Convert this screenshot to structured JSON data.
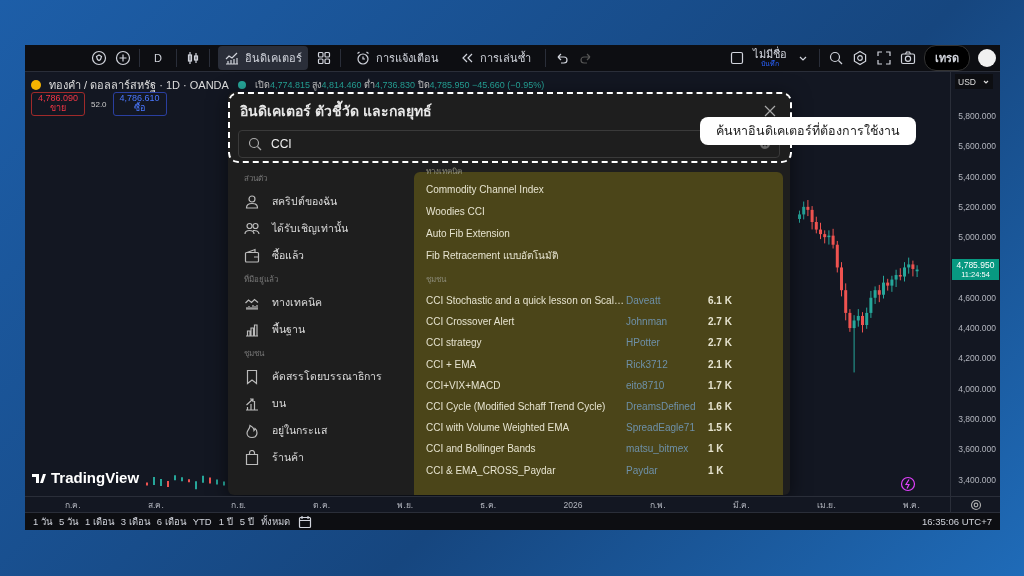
{
  "toolbar": {
    "interval": "D",
    "indicators": {
      "label": "อินดิเคเตอร์",
      "selected": true
    },
    "alerts_label": "การแจ้งเตือน",
    "replay_label": "การเล่นซ้ำ",
    "layout_name": "ไม่มีชื่อ",
    "layout_status": "บันทึก",
    "trade_button": "เทรด"
  },
  "legend": {
    "symbol": "ทองคำ / ดอลลาร์สหรัฐ · 1D · OANDA",
    "ohlc": [
      {
        "label": "เปิด",
        "value": "4,774.815"
      },
      {
        "label": "สูง",
        "value": "4,814.460"
      },
      {
        "label": "ต่ำ",
        "value": "4,736.830"
      },
      {
        "label": "ปิด",
        "value": "4,785.950"
      }
    ],
    "change": "−45.660 (−0.95%)"
  },
  "quote": {
    "sell_price": "4,786.090",
    "sell_label": "ขาย",
    "spread": "52.0",
    "buy_price": "4,786.610",
    "buy_label": "ซื้อ"
  },
  "chart": {
    "chart_data": {
      "type": "candlestick",
      "categories": [
        null,
        null,
        null,
        null,
        null,
        null,
        null,
        null,
        null,
        null,
        null,
        null,
        null,
        null,
        null,
        null,
        null,
        null,
        null,
        null,
        null,
        null,
        null,
        null,
        null,
        null,
        null,
        null,
        null
      ],
      "ohlc": [
        [
          5120,
          5175,
          5095,
          5150
        ],
        [
          5150,
          5235,
          5117,
          5200
        ],
        [
          5200,
          5245,
          5139,
          5180
        ],
        [
          5180,
          5205,
          5051,
          5100
        ],
        [
          5100,
          5135,
          5025,
          5050
        ],
        [
          5050,
          5095,
          4987,
          5020
        ],
        [
          5020,
          5045,
          4959,
          5000
        ],
        [
          5000,
          5045,
          4951,
          5010
        ],
        [
          5010,
          5055,
          4925,
          4950
        ],
        [
          4950,
          4975,
          4767,
          4800
        ],
        [
          4800,
          4835,
          4609,
          4650
        ],
        [
          4650,
          4695,
          4451,
          4500
        ],
        [
          4500,
          4525,
          4375,
          4400
        ],
        [
          4400,
          4485,
          4107,
          4450
        ],
        [
          4450,
          4525,
          4409,
          4480
        ],
        [
          4480,
          4505,
          4371,
          4420
        ],
        [
          4420,
          4535,
          4395,
          4500
        ],
        [
          4500,
          4645,
          4467,
          4600
        ],
        [
          4600,
          4675,
          4559,
          4650
        ],
        [
          4650,
          4685,
          4571,
          4620
        ],
        [
          4620,
          4745,
          4595,
          4700
        ],
        [
          4700,
          4725,
          4647,
          4680
        ],
        [
          4680,
          4745,
          4639,
          4720
        ],
        [
          4720,
          4785,
          4671,
          4750
        ],
        [
          4750,
          4795,
          4715,
          4740
        ],
        [
          4740,
          4835,
          4707,
          4800
        ],
        [
          4800,
          4865,
          4759,
          4820
        ],
        [
          4820,
          4845,
          4741,
          4790
        ],
        [
          4774.815,
          4814.46,
          4736.83,
          4785.95
        ]
      ],
      "ylim": [
        3186,
        6090
      ],
      "yticks": [
        {
          "value": 5800,
          "label": "5,800.000"
        },
        {
          "value": 5600,
          "label": "5,600.000"
        },
        {
          "value": 5400,
          "label": "5,400.000"
        },
        {
          "value": 5200,
          "label": "5,200.000"
        },
        {
          "value": 5000,
          "label": "5,000.000"
        },
        {
          "value": 4600,
          "label": "4,600.000"
        },
        {
          "value": 4400,
          "label": "4,400.000"
        },
        {
          "value": 4200,
          "label": "4,200.000"
        },
        {
          "value": 4000,
          "label": "4,000.000"
        },
        {
          "value": 3800,
          "label": "3,800.000"
        },
        {
          "value": 3600,
          "label": "3,600.000"
        },
        {
          "value": 3400,
          "label": "3,400.000"
        }
      ]
    }
  },
  "modal": {
    "title": "อินดิเคเตอร์ ตัวชี้วัด และกลยุทธ์",
    "search_value": "CCI",
    "sidebar": [
      {
        "heading": "ส่วนตัว",
        "items": [
          {
            "label": "สคริปต์ของฉัน"
          },
          {
            "label": "ได้รับเชิญเท่านั้น"
          },
          {
            "label": "ซื้อแล้ว"
          }
        ]
      },
      {
        "heading": "ที่มีอยู่แล้ว",
        "items": [
          {
            "label": "ทางเทคนิค"
          },
          {
            "label": "พื้นฐาน"
          }
        ]
      },
      {
        "heading": "ชุมชน",
        "items": [
          {
            "label": "คัดสรรโดยบรรณาธิการ"
          },
          {
            "label": "บน"
          },
          {
            "label": "อยู่ในกระแส"
          },
          {
            "label": "ร้านค้า"
          }
        ]
      }
    ],
    "technical_heading": "ทางเทคนิค",
    "technical": [
      "Commodity Channel Index",
      "Woodies CCI",
      "Auto Fib Extension",
      "Fib Retracement แบบอัตโนมัติ"
    ],
    "community_heading": "ชุมชน",
    "community": [
      {
        "name": "CCI Stochastic and a quick lesson on Scal…",
        "author": "Daveatt",
        "count": "6.1 K"
      },
      {
        "name": "CCI Crossover Alert",
        "author": "Johnman",
        "count": "2.7 K"
      },
      {
        "name": "CCI strategy",
        "author": "HPotter",
        "count": "2.7 K"
      },
      {
        "name": "CCI + EMA",
        "author": "Rick3712",
        "count": "2.1 K"
      },
      {
        "name": "CCI+VIX+MACD",
        "author": "eito8710",
        "count": "1.7 K"
      },
      {
        "name": "CCI Cycle (Modified Schaff Trend Cycle)",
        "author": "DreamsDefined",
        "count": "1.6 K"
      },
      {
        "name": "CCI with Volume Weighted EMA",
        "author": "SpreadEagle71",
        "count": "1.5 K"
      },
      {
        "name": "CCI and Bollinger Bands",
        "author": "matsu_bitmex",
        "count": "1 K"
      },
      {
        "name": "CCI & EMA_CROSS_Paydar",
        "author": "Paydar",
        "count": "1 K"
      }
    ]
  },
  "callout": "ค้นหาอินดิเคเตอร์ที่ต้องการใช้งาน",
  "price_axis": {
    "currency": "USD",
    "last_price": "4,785.950",
    "countdown": "11:24:54"
  },
  "time_axis": [
    "ก.ค.",
    "ส.ค.",
    "ก.ย.",
    "ต.ค.",
    "พ.ย.",
    "ธ.ค.",
    "2026",
    "ก.พ.",
    "มี.ค.",
    "เม.ย.",
    "พ.ค."
  ],
  "brand": "TradingView",
  "ranges": [
    "1 วัน",
    "5 วัน",
    "1 เดือน",
    "3 เดือน",
    "6 เดือน",
    "YTD",
    "1 ปี",
    "5 ปี",
    "ทั้งหมด"
  ],
  "clock": "16:35:06 UTC+7"
}
